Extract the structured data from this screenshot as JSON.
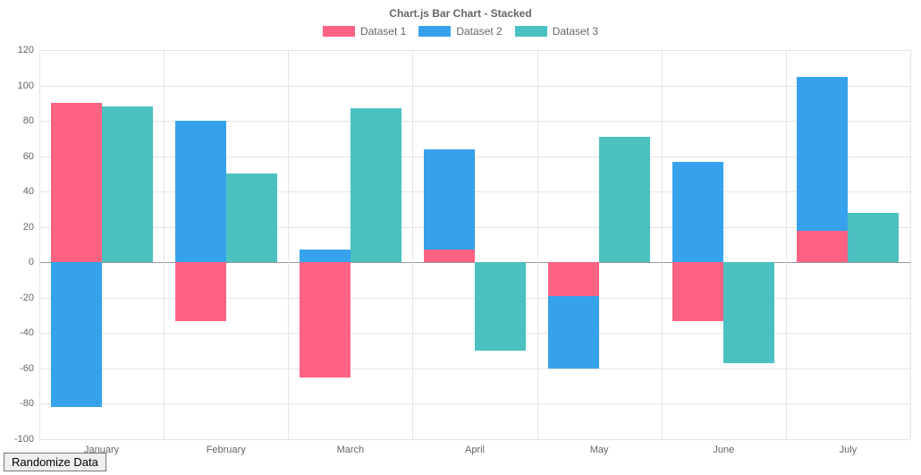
{
  "chart_data": {
    "type": "bar",
    "title": "Chart.js Bar Chart - Stacked",
    "categories": [
      "January",
      "February",
      "March",
      "April",
      "May",
      "June",
      "July"
    ],
    "ylim": [
      -100,
      120
    ],
    "ystep": 20,
    "series": [
      {
        "name": "Dataset 1",
        "color": "#ff6384",
        "stack": "A",
        "values": [
          90,
          -33,
          -65,
          7,
          -19,
          -33,
          18
        ]
      },
      {
        "name": "Dataset 2",
        "color": "#36a2eb",
        "stack": "A",
        "values": [
          -82,
          80,
          7,
          57,
          -41,
          57,
          87
        ]
      },
      {
        "name": "Dataset 3",
        "color": "#4bc0c0",
        "stack": "B",
        "values": [
          88,
          50,
          87,
          -50,
          71,
          -57,
          28
        ]
      }
    ]
  },
  "button": {
    "randomize_label": "Randomize Data"
  }
}
